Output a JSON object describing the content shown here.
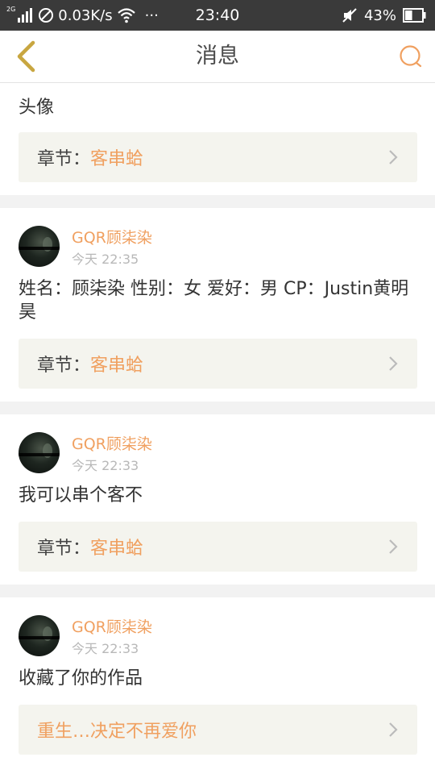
{
  "status_bar": {
    "network_type": "2G",
    "speed": "0.03K/s",
    "more": "···",
    "time": "23:40",
    "battery_percent": "43%",
    "battery_level": 0.43
  },
  "header": {
    "title": "消息"
  },
  "messages": [
    {
      "text": "头像",
      "chapter_label": "章节：",
      "chapter_value": "客串蛤"
    },
    {
      "username": "GQR顾柒染",
      "time": "今天 22:35",
      "text": "姓名：顾柒染 性别：女 爱好：男 CP：Justin黄明昊",
      "chapter_label": "章节：",
      "chapter_value": "客串蛤"
    },
    {
      "username": "GQR顾柒染",
      "time": "今天 22:33",
      "text": "我可以串个客不",
      "chapter_label": "章节：",
      "chapter_value": "客串蛤"
    },
    {
      "username": "GQR顾柒染",
      "time": "今天 22:33",
      "text": "收藏了你的作品",
      "work_title": "重生…决定不再爱你"
    }
  ],
  "colors": {
    "accent": "#f0a060",
    "back_icon": "#c8a640",
    "status_bar_bg": "#3a3a3a",
    "link_box_bg": "#f4f4ee",
    "separator": "#f2f2f2"
  }
}
